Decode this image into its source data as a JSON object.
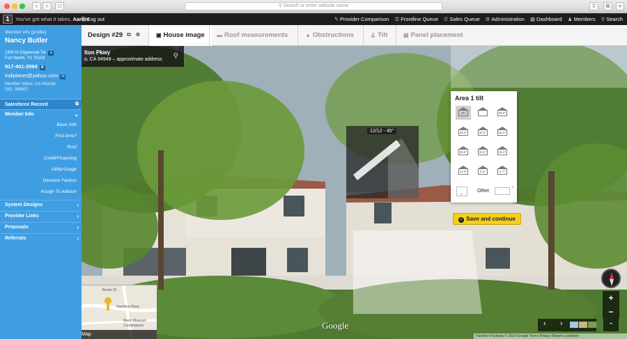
{
  "browser": {
    "url_placeholder": "Search or enter website name"
  },
  "topbar": {
    "tagline": "You've got what it takes,",
    "user": "Aaron!",
    "logout": "Log out",
    "nav": [
      {
        "label": "Provider Comparison",
        "icon": "pencil-icon"
      },
      {
        "label": "Frontline Queue",
        "icon": "list-icon"
      },
      {
        "label": "Sales Queue",
        "icon": "phone-icon"
      },
      {
        "label": "Administration",
        "icon": "gear-icon"
      },
      {
        "label": "Dashboard",
        "icon": "grid-icon"
      },
      {
        "label": "Members",
        "icon": "people-icon"
      },
      {
        "label": "Search",
        "icon": "search-icon"
      }
    ]
  },
  "member": {
    "title": "Member info",
    "profile_link": "[profile]",
    "name": "Nancy Butler",
    "address_line1": "2300 N Edgewood Ter",
    "address_line2": "Fort Worth, TX 76103",
    "phone": "817-401-3594",
    "email": "indiplanet@yahoo.com",
    "status": "Member status: 1st Attempt",
    "uid": "UID: 366007"
  },
  "sidebar": {
    "salesforce": "Salesforce Record",
    "member_info": "Member Info",
    "sub_items": [
      "Basic Info",
      "First-time?",
      "Roof",
      "Credit/Financing",
      "Utility/Usage",
      "Decision Factors",
      "Assign To Advisor"
    ],
    "sections": [
      "System Designs",
      "Provider Links",
      "Proposals",
      "Referrals"
    ]
  },
  "design": {
    "title": "Design #29",
    "tabs": [
      {
        "label": "House image",
        "icon": "camera-icon",
        "active": true
      },
      {
        "label": "Roof measurements",
        "icon": "ruler-icon",
        "active": false
      },
      {
        "label": "Obstructions",
        "icon": "cone-icon",
        "active": false
      },
      {
        "label": "Tilt",
        "icon": "angle-icon",
        "active": false
      },
      {
        "label": "Panel placement",
        "icon": "panel-icon",
        "active": false
      }
    ]
  },
  "address_card": {
    "street": "lton Pkwy",
    "city": "o, CA 94949 – approximate address"
  },
  "pitch_label": "12/12 - 45°",
  "tilt_panel": {
    "title": "Area 1 tilt",
    "options": [
      "45°",
      "",
      "39.8°",
      "36.8°",
      "33.6°",
      "30.2°",
      "26.5°",
      "22.6°",
      "18.4°",
      "14.0°",
      "9.4°",
      "4.7°"
    ],
    "selected_index": 0,
    "other_swatch": "0°",
    "other_label": "Other",
    "degree_symbol": "°"
  },
  "save_button": "Save and continue",
  "minimap": {
    "label": "Map",
    "streets": [
      "Brown Dr",
      "Hamilton Pkwy",
      "Marin Museum",
      "Contemporar"
    ]
  },
  "streetview": {
    "google": "Google",
    "footer": "Hamilton Parkway   © 2014 Google   Terms   Privacy   Report a problem"
  },
  "colors": {
    "sidebar": "#3f9ee2",
    "save_button": "#f5ce1a",
    "topbar": "#1d1d1d"
  }
}
